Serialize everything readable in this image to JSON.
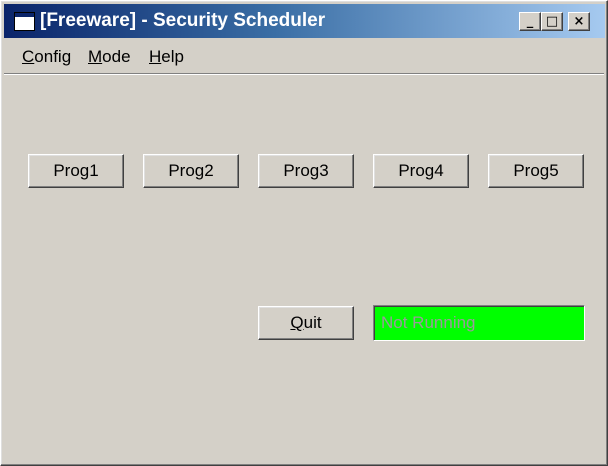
{
  "window": {
    "title": "[Freeware] - Security Scheduler",
    "controls": {
      "minimize": "_",
      "maximize": "□",
      "close": "×"
    }
  },
  "menu": {
    "items": [
      {
        "accel": "C",
        "rest": "onfig"
      },
      {
        "accel": "M",
        "rest": "ode"
      },
      {
        "accel": "H",
        "rest": "elp"
      }
    ]
  },
  "programs": [
    "Prog1",
    "Prog2",
    "Prog3",
    "Prog4",
    "Prog5"
  ],
  "quit": {
    "accel": "Q",
    "rest": "uit"
  },
  "status": {
    "text": "Not Running",
    "background": "#00ff00"
  },
  "colors": {
    "window_face": "#d4d0c8",
    "title_gradient_start": "#0a246a",
    "title_gradient_end": "#a6caf0"
  },
  "icons": {
    "app": "window-app-icon"
  }
}
